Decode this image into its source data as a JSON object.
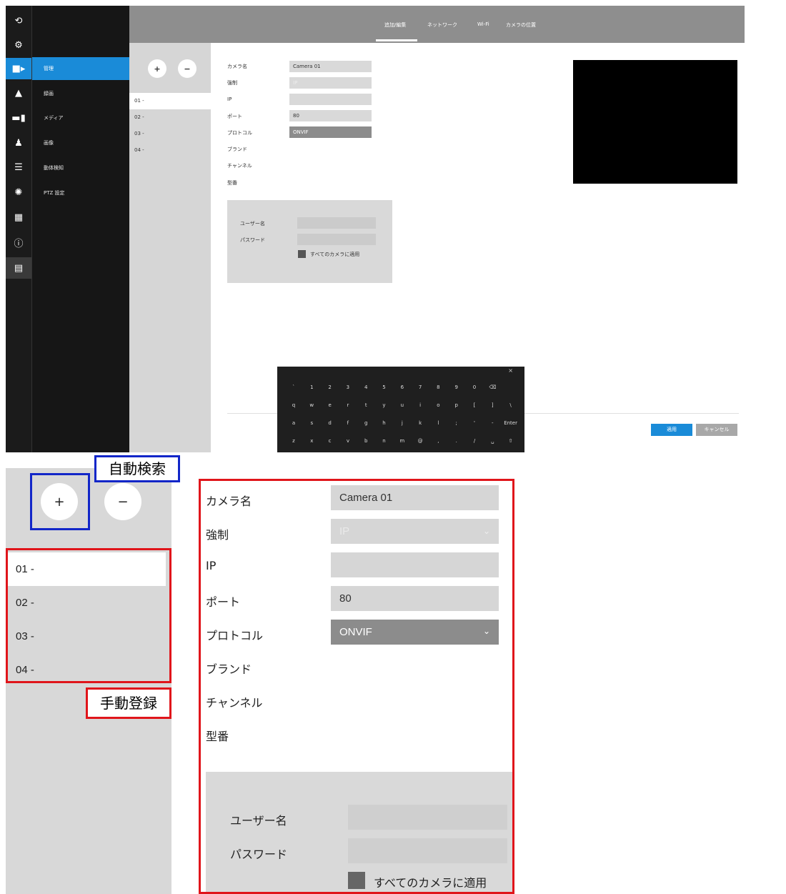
{
  "shot": {
    "icons": [
      "refresh-icon",
      "gear-icon",
      "camera-icon",
      "alert-icon",
      "monitor-icon",
      "person-icon",
      "database-icon",
      "network-icon",
      "grid-icon",
      "info-icon",
      "cast-icon"
    ],
    "menu": [
      "管理",
      "録画",
      "メディア",
      "画像",
      "動体検知",
      "PTZ 設定"
    ],
    "tabs": [
      "追加/編集",
      "ネットワーク",
      "Wi-Fi",
      "カメラの位置"
    ],
    "add_btn": "+",
    "remove_btn": "−",
    "cameras": [
      "01 -",
      "02 -",
      "03 -",
      "04 -"
    ],
    "form": {
      "camera_name_label": "カメラ名",
      "camera_name_value": "Camera 01",
      "force_label": "強制",
      "force_value": "IP",
      "ip_label": "IP",
      "ip_value": "",
      "port_label": "ポート",
      "port_value": "80",
      "protocol_label": "プロトコル",
      "protocol_value": "ONVIF",
      "brand_label": "ブランド",
      "channel_label": "チャンネル",
      "model_label": "型番"
    },
    "credentials": {
      "username_label": "ユーザー名",
      "password_label": "パスワード",
      "apply_all_label": "すべてのカメラに適用"
    },
    "apply_button": "適用",
    "cancel_button": "キャンセル",
    "keyboard": {
      "row1": [
        "`",
        "1",
        "2",
        "3",
        "4",
        "5",
        "6",
        "7",
        "8",
        "9",
        "0",
        "⌫"
      ],
      "row2": [
        "q",
        "w",
        "e",
        "r",
        "t",
        "y",
        "u",
        "i",
        "o",
        "p",
        "[",
        "]",
        "\\"
      ],
      "row3": [
        "a",
        "s",
        "d",
        "f",
        "g",
        "h",
        "j",
        "k",
        "l",
        ";",
        "'",
        "-",
        "Enter"
      ],
      "row4": [
        "z",
        "x",
        "c",
        "v",
        "b",
        "n",
        "m",
        "@",
        ",",
        ".",
        "/",
        "␣",
        "⇧"
      ]
    }
  },
  "zoom": {
    "auto_search_label": "自動検索",
    "manual_label": "手動登録",
    "add_btn": "+",
    "remove_btn": "−",
    "cameras": [
      "01 -",
      "02 -",
      "03 -",
      "04 -"
    ],
    "form": {
      "camera_name_label": "カメラ名",
      "camera_name_value": "Camera 01",
      "force_label": "強制",
      "force_value": "IP",
      "ip_label": "IP",
      "port_label": "ポート",
      "port_value": "80",
      "protocol_label": "プロトコル",
      "protocol_value": "ONVIF",
      "brand_label": "ブランド",
      "channel_label": "チャンネル",
      "model_label": "型番",
      "username_label": "ユーザー名",
      "password_label": "パスワード",
      "apply_all_label": "すべてのカメラに適用"
    }
  }
}
